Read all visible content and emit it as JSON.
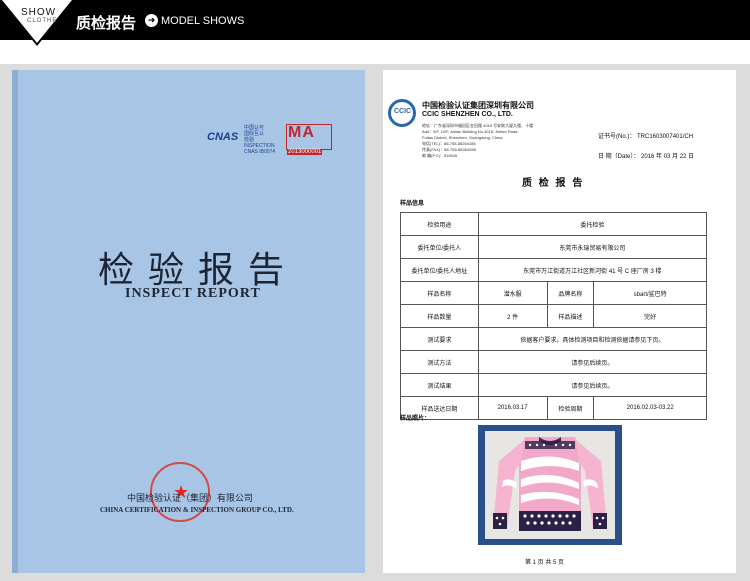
{
  "header": {
    "brand_top": "SHOW",
    "brand_bottom": "CLOTHE",
    "title": "质检报告",
    "subtitle": "MODEL SHOWS",
    "icon": "circle-arrow-icon"
  },
  "cover": {
    "cnas_label": "CNAS",
    "cnas_lines": [
      "中国认可",
      "国际互认",
      "检验",
      "INSPECTION",
      "CNAS IB0074"
    ],
    "ma_label": "MA",
    "ma_number": "2013000001",
    "title": "检验报告",
    "subtitle": "INSPECT   REPORT",
    "org": "中国检验认证（集团）有限公司",
    "org_en": "CHINA CERTIFICATION & INSPECTION GROUP CO., LTD."
  },
  "report": {
    "logo_text": "CCIC",
    "company": "中国检验认证集团深圳有限公司",
    "company_en": "CCIC SHENZHEN CO., LTD.",
    "address_lines": [
      "地址：广东省深圳市福田区金田路 4018 号安联大厦九楼、十楼",
      "Add：9/F, 10/F, Anlian Building No.4018, Jintian Road,",
      "Futian District, Shenzhen, Guangdong, China",
      "电话(TEL)：86-755-88264188",
      "传真(FAX)：86-755-88264288",
      "邮 编(P.C)：518026"
    ],
    "cert_label": "证书号(No.)：",
    "cert_no": "TRC1603007401/CH",
    "date_label": "日   期（Date）：",
    "date": "2016 年 03 月 22 日",
    "heading": "质 检 报 告",
    "section_info": "样品信息",
    "section_photo": "样品照片：",
    "rows": {
      "purpose_label": "检验用途",
      "purpose": "委托检验",
      "client_label": "委托单位/委托人",
      "client": "东莞市永瑞贸易有限公司",
      "addr_label": "委托单位/委托人地址",
      "addr": "东莞市万江街道万江社区新河街 41 号 C 座厂房 3 楼",
      "sample_name_label": "样品名称",
      "sample_name": "潜水服",
      "brand_label": "品牌名称",
      "brand": "sbart/鲨巴特",
      "qty_label": "样品数量",
      "qty": "2 件",
      "desc_label": "样品描述",
      "desc": "完好",
      "req_label": "测试要求",
      "req": "依据客户要求，具体检测项目和检测依据请参见下页。",
      "method_label": "测试方法",
      "method": "请参见后续页。",
      "result_label": "测试结果",
      "result": "请参见后续页。",
      "sent_label": "样品送达日期",
      "sent": "2016.03.17",
      "period_label": "检验周期",
      "period": "2016.02.03-03.22"
    },
    "page_footer": "第 1 页 共 5 页"
  }
}
